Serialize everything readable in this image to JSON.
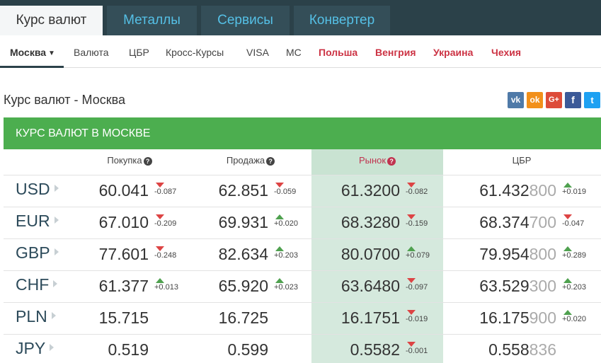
{
  "top_tabs": [
    "Курс валют",
    "Металлы",
    "Сервисы",
    "Конвертер"
  ],
  "sub_nav": {
    "city": "Москва",
    "items": [
      "Валюта",
      "ЦБР",
      "Кросс-Курсы",
      "VISA",
      "MC"
    ],
    "countries": [
      "Польша",
      "Венгрия",
      "Украина",
      "Чехия"
    ]
  },
  "page_title": "Курс валют - Москва",
  "social": [
    {
      "label": "vk",
      "color": "#4f7aa8"
    },
    {
      "label": "ok",
      "color": "#f2901a"
    },
    {
      "label": "G+",
      "color": "#dd4b39"
    },
    {
      "label": "f",
      "color": "#3b5998"
    },
    {
      "label": "t",
      "color": "#1da1f2"
    }
  ],
  "table_title": "КУРС ВАЛЮТ В МОСКВЕ",
  "columns": [
    "Покупка",
    "Продажа",
    "Рынок",
    "ЦБР"
  ],
  "rows": [
    {
      "cur": "USD",
      "buy": "60.041",
      "buy_chg": "-0.087",
      "buy_dir": "down",
      "sell": "62.851",
      "sell_chg": "-0.059",
      "sell_dir": "down",
      "market": "61.3200",
      "market_chg": "-0.082",
      "market_dir": "down",
      "cbr_main": "61.432",
      "cbr_tail": "800",
      "cbr_chg": "+0.019",
      "cbr_dir": "up"
    },
    {
      "cur": "EUR",
      "buy": "67.010",
      "buy_chg": "-0.209",
      "buy_dir": "down",
      "sell": "69.931",
      "sell_chg": "+0.020",
      "sell_dir": "up",
      "market": "68.3280",
      "market_chg": "-0.159",
      "market_dir": "down",
      "cbr_main": "68.374",
      "cbr_tail": "700",
      "cbr_chg": "-0.047",
      "cbr_dir": "down"
    },
    {
      "cur": "GBP",
      "buy": "77.601",
      "buy_chg": "-0.248",
      "buy_dir": "down",
      "sell": "82.634",
      "sell_chg": "+0.203",
      "sell_dir": "up",
      "market": "80.0700",
      "market_chg": "+0.079",
      "market_dir": "up",
      "cbr_main": "79.954",
      "cbr_tail": "800",
      "cbr_chg": "+0.289",
      "cbr_dir": "up"
    },
    {
      "cur": "CHF",
      "buy": "61.377",
      "buy_chg": "+0.013",
      "buy_dir": "up",
      "sell": "65.920",
      "sell_chg": "+0.023",
      "sell_dir": "up",
      "market": "63.6480",
      "market_chg": "-0.097",
      "market_dir": "down",
      "cbr_main": "63.529",
      "cbr_tail": "300",
      "cbr_chg": "+0.203",
      "cbr_dir": "up"
    },
    {
      "cur": "PLN",
      "buy": "15.715",
      "buy_chg": "",
      "buy_dir": "",
      "sell": "16.725",
      "sell_chg": "",
      "sell_dir": "",
      "market": "16.1751",
      "market_chg": "-0.019",
      "market_dir": "down",
      "cbr_main": "16.175",
      "cbr_tail": "900",
      "cbr_chg": "+0.020",
      "cbr_dir": "up"
    },
    {
      "cur": "JPY",
      "buy": "0.519",
      "buy_chg": "",
      "buy_dir": "",
      "sell": "0.599",
      "sell_chg": "",
      "sell_dir": "",
      "market": "0.5582",
      "market_chg": "-0.001",
      "market_dir": "down",
      "cbr_main": "0.558",
      "cbr_tail": "836",
      "cbr_chg": "",
      "cbr_dir": ""
    }
  ]
}
